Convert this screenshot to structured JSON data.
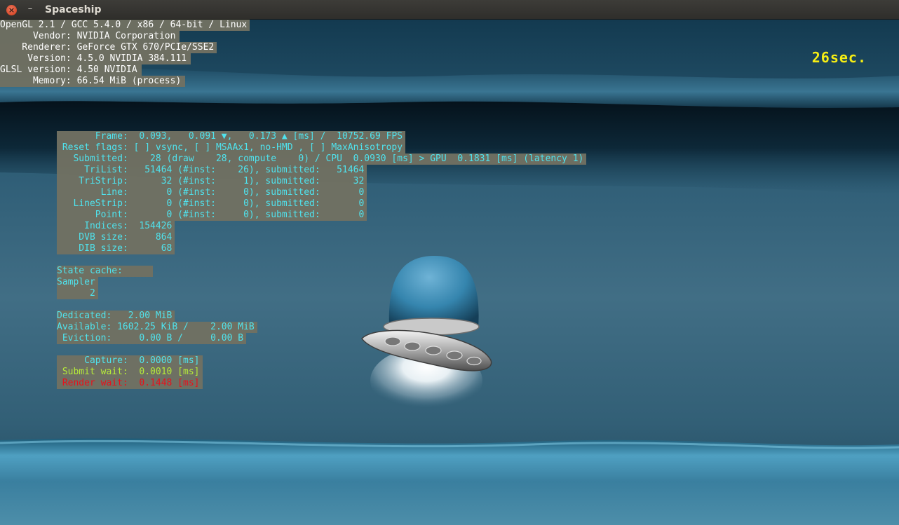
{
  "window": {
    "title": "Spaceship",
    "close_glyph": "×",
    "minimize_glyph": "–",
    "close_icon": "close-icon",
    "minimize_icon": "minimize-icon"
  },
  "hud": {
    "timer": "26sec.",
    "timer_color": "#f6ee14"
  },
  "sysinfo": [
    "OpenGL 2.1 / GCC 5.4.0 / x86 / 64-bit / Linux",
    "      Vendor: NVIDIA Corporation",
    "    Renderer: GeForce GTX 670/PCIe/SSE2",
    "     Version: 4.5.0 NVIDIA 384.111",
    "GLSL version: 4.50 NVIDIA",
    "      Memory: 66.54 MiB (process)"
  ],
  "perf": {
    "frame": "       Frame:  0.093,   0.091 ▼,   0.173 ▲ [ms] /  10752.69 FPS",
    "reset_flags": " Reset flags: [ ] vsync, [ ] MSAAx1, no-HMD , [ ] MaxAnisotropy",
    "submitted": "   Submitted:    28 (draw    28, compute    0) / CPU  0.0930 [ms] > GPU  0.1831 [ms] (latency 1)",
    "tri_list": "     TriList:   51464 (#inst:    26), submitted:   51464",
    "tri_strip": "    TriStrip:      32 (#inst:     1), submitted:      32",
    "line": "        Line:       0 (#inst:     0), submitted:       0",
    "line_strip": "   LineStrip:       0 (#inst:     0), submitted:       0",
    "point": "       Point:       0 (#inst:     0), submitted:       0",
    "indices": "     Indices:  154426",
    "dvb_size": "    DVB size:     864",
    "dib_size": "    DIB size:      68"
  },
  "cache": {
    "state_cache": "State cache:     ",
    "sampler": "Sampler",
    "sampler_value": "      2"
  },
  "gpu_memory": {
    "dedicated": "Dedicated:   2.00 MiB",
    "available": "Available: 1602.25 KiB /    2.00 MiB",
    "eviction": " Eviction:     0.00 B /     0.00 B"
  },
  "waits": {
    "capture": "     Capture:  0.0000 [ms]",
    "submit_wait": " Submit wait:  0.0010 [ms]",
    "render_wait": " Render wait:  0.1448 [ms]"
  },
  "colors": {
    "stats_text": "#4fe3ee",
    "stats_background": "#707062",
    "submit_wait": "#b6ec3a",
    "render_wait": "#e8111c",
    "close_button": "#d94b2b"
  }
}
